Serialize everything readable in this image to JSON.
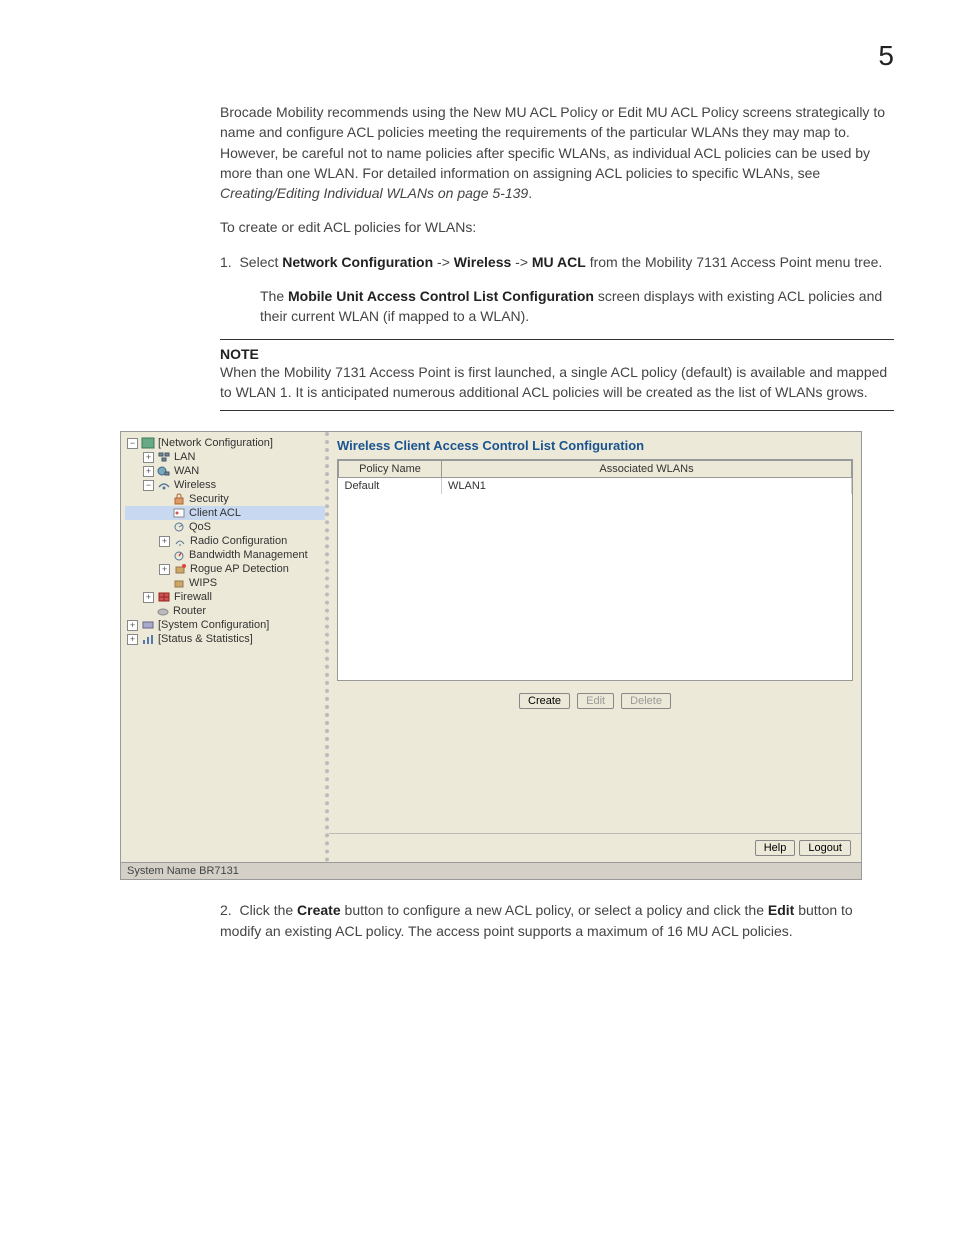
{
  "page_number": "5",
  "paragraphs": {
    "intro": "Brocade Mobility recommends using the New MU ACL Policy or Edit MU ACL Policy screens strategically to name and configure ACL policies meeting the requirements of the particular WLANs they may map to. However, be careful not to name policies after specific WLANs, as individual ACL policies can be used by more than one WLAN. For detailed information on assigning ACL policies to specific WLANs, see ",
    "intro_ref": "Creating/Editing Individual WLANs on page 5-139",
    "intro_end": ".",
    "lead": "To create or edit ACL policies for WLANs:",
    "step1_pre": "Select ",
    "step1_b1": "Network Configuration",
    "step1_mid1": " -> ",
    "step1_b2": "Wireless",
    "step1_mid2": " -> ",
    "step1_b3": "MU ACL",
    "step1_post": " from the Mobility 7131 Access Point menu tree.",
    "step1_sub_pre": "The ",
    "step1_sub_b": "Mobile Unit Access Control List Configuration",
    "step1_sub_post": " screen displays with existing ACL policies and their current WLAN (if mapped to a WLAN).",
    "note_label": "NOTE",
    "note_body": "When the Mobility 7131 Access Point is first launched, a single ACL policy (default) is available and mapped to WLAN 1. It is anticipated numerous additional ACL policies will be created as the list of WLANs grows.",
    "step2_pre": "Click the ",
    "step2_b1": "Create",
    "step2_mid": " button to configure a new ACL policy, or select a policy and click the ",
    "step2_b2": "Edit",
    "step2_post": " button to modify an existing ACL policy. The access point supports a maximum of 16 MU ACL policies."
  },
  "screenshot": {
    "panel_title": "Wireless Client Access Control List Configuration",
    "tree": {
      "root1": "[Network Configuration]",
      "lan": "LAN",
      "wan": "WAN",
      "wireless": "Wireless",
      "security": "Security",
      "client_acl": "Client ACL",
      "qos": "QoS",
      "radio": "Radio Configuration",
      "bandwidth": "Bandwidth Management",
      "rogue": "Rogue AP Detection",
      "wips": "WIPS",
      "firewall": "Firewall",
      "router": "Router",
      "sysconf": "[System Configuration]",
      "status": "[Status & Statistics]"
    },
    "table": {
      "col1": "Policy Name",
      "col2": "Associated WLANs",
      "row1_name": "Default",
      "row1_wlan": "WLAN1"
    },
    "buttons": {
      "create": "Create",
      "edit": "Edit",
      "delete": "Delete",
      "help": "Help",
      "logout": "Logout"
    },
    "statusbar": "System Name BR7131"
  }
}
